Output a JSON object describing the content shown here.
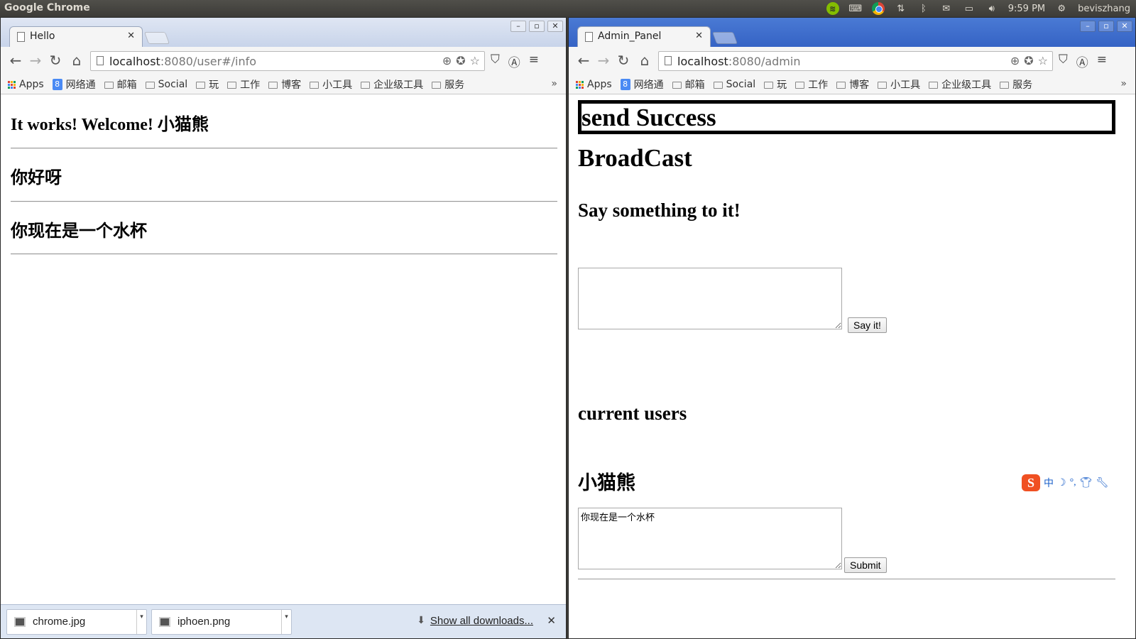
{
  "topbar": {
    "app_title": "Google Chrome",
    "time": "9:59 PM",
    "user": "beviszhang"
  },
  "left_window": {
    "tab_title": "Hello",
    "url_host": "localhost",
    "url_path": ":8080/user#/info",
    "page": {
      "heading": "It works! Welcome! 小猫熊",
      "greeting": "你好呀",
      "message": "你现在是一个水杯"
    },
    "downloads": {
      "items": [
        "chrome.jpg",
        "iphoen.png"
      ],
      "show_all": "Show all downloads..."
    }
  },
  "right_window": {
    "tab_title": "Admin_Panel",
    "url_host": "localhost",
    "url_path": ":8080/admin",
    "page": {
      "status": "send Success",
      "broadcast_title": "BroadCast",
      "prompt": "Say something to it!",
      "broadcast_value": "",
      "say_button": "Say it!",
      "users_title": "current users",
      "user_name": "小猫熊",
      "user_message": "你现在是一个水杯",
      "submit_button": "Submit"
    },
    "ime": {
      "mode": "中",
      "logo": "S"
    }
  },
  "bookmarks": [
    "Apps",
    "网络通",
    "邮箱",
    "Social",
    "玩",
    "工作",
    "博客",
    "小工具",
    "企业级工具",
    "服务"
  ],
  "bookmarks_more": "»",
  "colors": {
    "ubuntu_panel": "#3c3b37",
    "chrome_frame_active": "#3563c5",
    "chrome_frame_inactive": "#c8d4ea",
    "downloads_shelf": "#dde6f3"
  }
}
